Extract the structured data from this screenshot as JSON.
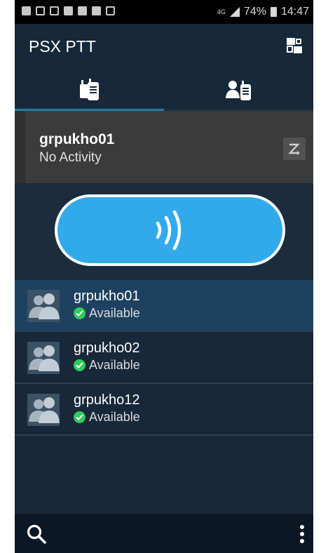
{
  "status_bar": {
    "network": "4G",
    "battery": "74%",
    "time": "14:47",
    "icons": [
      "sim-icon",
      "image-icon",
      "notification-icon",
      "group-icon",
      "group-icon",
      "flipboard-icon",
      "voicemail-icon"
    ]
  },
  "app": {
    "title": "PSX PTT",
    "menu_icon": "window-toggle-icon"
  },
  "tabs": [
    {
      "icon": "radio-channels-icon",
      "active": true
    },
    {
      "icon": "contacts-radio-icon",
      "active": false
    }
  ],
  "active_group": {
    "name": "grpukho01",
    "status": "No Activity",
    "action_icon": "scan-icon"
  },
  "ptt": {
    "icon": "talk-waves-icon"
  },
  "groups": [
    {
      "name": "grpukho01",
      "status": "Available",
      "selected": true
    },
    {
      "name": "grpukho02",
      "status": "Available",
      "selected": false
    },
    {
      "name": "grpukho12",
      "status": "Available",
      "selected": false
    }
  ],
  "bottom_bar": {
    "search_icon": "search-icon",
    "more_icon": "more-vertical-icon"
  },
  "colors": {
    "accent": "#2aa0de",
    "ptt_button": "#32aaea",
    "background": "#16283a",
    "selected_row": "#1e4160",
    "available": "#2ecc5b"
  }
}
